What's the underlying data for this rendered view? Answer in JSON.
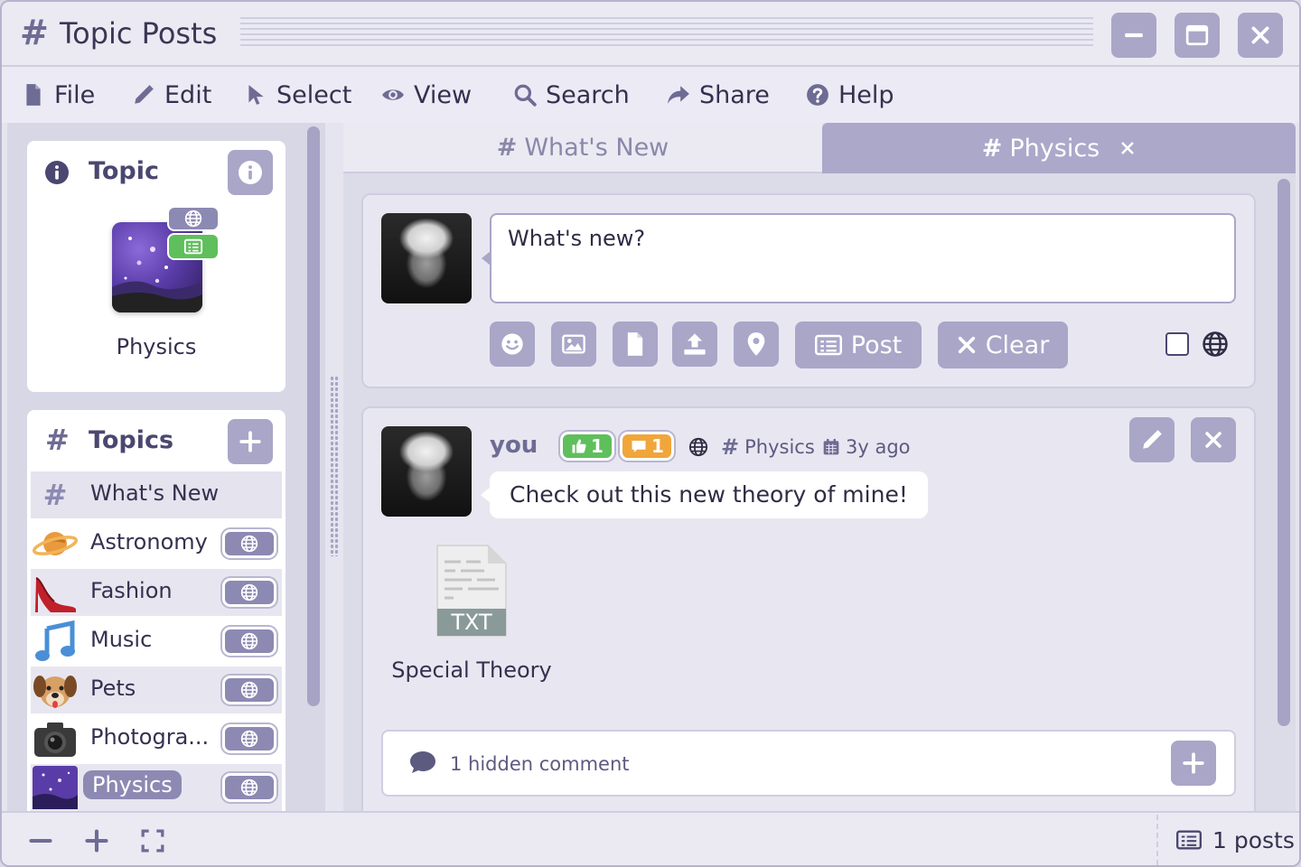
{
  "window": {
    "title": "Topic Posts",
    "title_icon": "hash-icon"
  },
  "menu": [
    {
      "label": "File",
      "icon": "file-icon"
    },
    {
      "label": "Edit",
      "icon": "pencil-icon"
    },
    {
      "label": "Select",
      "icon": "pointer-icon"
    },
    {
      "label": "View",
      "icon": "eye-icon"
    },
    {
      "label": "Search",
      "icon": "search-icon"
    },
    {
      "label": "Share",
      "icon": "share-icon"
    },
    {
      "label": "Help",
      "icon": "help-icon"
    }
  ],
  "topic_card": {
    "title": "Topic",
    "name": "Physics"
  },
  "topics": {
    "title": "Topics",
    "items": [
      {
        "label": "What's New",
        "icon": "hash-icon"
      },
      {
        "label": "Astronomy",
        "icon": "planet-icon"
      },
      {
        "label": "Fashion",
        "icon": "high-heel-icon"
      },
      {
        "label": "Music",
        "icon": "music-note-icon"
      },
      {
        "label": "Pets",
        "icon": "dog-icon"
      },
      {
        "label": "Photogra...",
        "icon": "camera-icon"
      },
      {
        "label": "Physics",
        "icon": "galaxy-icon",
        "selected": true
      }
    ]
  },
  "tabs": [
    {
      "label": "What's New",
      "active": false
    },
    {
      "label": "Physics",
      "active": true
    }
  ],
  "composer": {
    "placeholder": "What's new?",
    "post_label": "Post",
    "clear_label": "Clear",
    "public_checked": false
  },
  "post": {
    "author": "you",
    "likes": "1",
    "comments": "1",
    "topic": "Physics",
    "age": "3y ago",
    "text": "Check out this new theory of mine!",
    "attachment": {
      "type": "TXT",
      "name": "Special Theory"
    },
    "hidden_comments": "1 hidden comment"
  },
  "status": {
    "post_count": "1 posts"
  },
  "colors": {
    "accent": "#a9a6c8",
    "like": "#5fbf5c",
    "comment": "#f0a63a",
    "text": "#34314f"
  }
}
